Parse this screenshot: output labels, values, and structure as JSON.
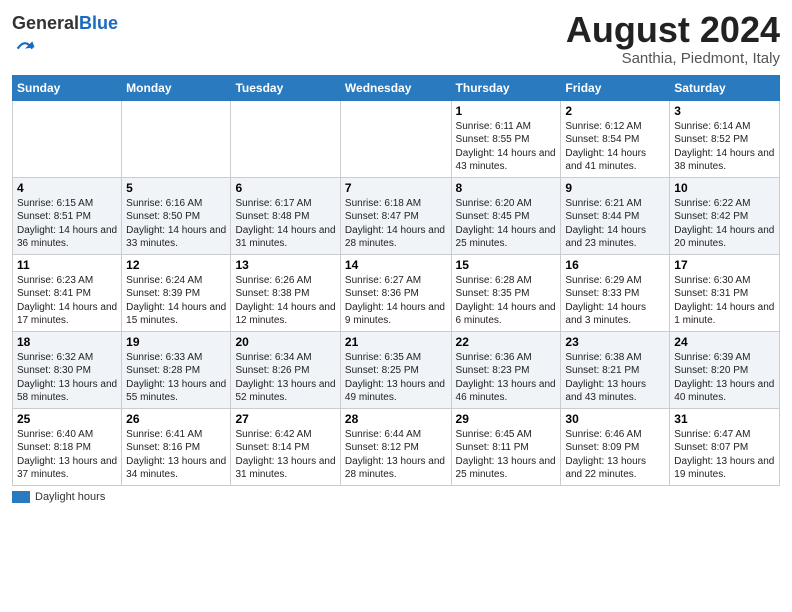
{
  "header": {
    "logo_general": "General",
    "logo_blue": "Blue",
    "month_title": "August 2024",
    "location": "Santhia, Piedmont, Italy"
  },
  "days_of_week": [
    "Sunday",
    "Monday",
    "Tuesday",
    "Wednesday",
    "Thursday",
    "Friday",
    "Saturday"
  ],
  "weeks": [
    [
      {
        "num": "",
        "info": ""
      },
      {
        "num": "",
        "info": ""
      },
      {
        "num": "",
        "info": ""
      },
      {
        "num": "",
        "info": ""
      },
      {
        "num": "1",
        "info": "Sunrise: 6:11 AM\nSunset: 8:55 PM\nDaylight: 14 hours and 43 minutes."
      },
      {
        "num": "2",
        "info": "Sunrise: 6:12 AM\nSunset: 8:54 PM\nDaylight: 14 hours and 41 minutes."
      },
      {
        "num": "3",
        "info": "Sunrise: 6:14 AM\nSunset: 8:52 PM\nDaylight: 14 hours and 38 minutes."
      }
    ],
    [
      {
        "num": "4",
        "info": "Sunrise: 6:15 AM\nSunset: 8:51 PM\nDaylight: 14 hours and 36 minutes."
      },
      {
        "num": "5",
        "info": "Sunrise: 6:16 AM\nSunset: 8:50 PM\nDaylight: 14 hours and 33 minutes."
      },
      {
        "num": "6",
        "info": "Sunrise: 6:17 AM\nSunset: 8:48 PM\nDaylight: 14 hours and 31 minutes."
      },
      {
        "num": "7",
        "info": "Sunrise: 6:18 AM\nSunset: 8:47 PM\nDaylight: 14 hours and 28 minutes."
      },
      {
        "num": "8",
        "info": "Sunrise: 6:20 AM\nSunset: 8:45 PM\nDaylight: 14 hours and 25 minutes."
      },
      {
        "num": "9",
        "info": "Sunrise: 6:21 AM\nSunset: 8:44 PM\nDaylight: 14 hours and 23 minutes."
      },
      {
        "num": "10",
        "info": "Sunrise: 6:22 AM\nSunset: 8:42 PM\nDaylight: 14 hours and 20 minutes."
      }
    ],
    [
      {
        "num": "11",
        "info": "Sunrise: 6:23 AM\nSunset: 8:41 PM\nDaylight: 14 hours and 17 minutes."
      },
      {
        "num": "12",
        "info": "Sunrise: 6:24 AM\nSunset: 8:39 PM\nDaylight: 14 hours and 15 minutes."
      },
      {
        "num": "13",
        "info": "Sunrise: 6:26 AM\nSunset: 8:38 PM\nDaylight: 14 hours and 12 minutes."
      },
      {
        "num": "14",
        "info": "Sunrise: 6:27 AM\nSunset: 8:36 PM\nDaylight: 14 hours and 9 minutes."
      },
      {
        "num": "15",
        "info": "Sunrise: 6:28 AM\nSunset: 8:35 PM\nDaylight: 14 hours and 6 minutes."
      },
      {
        "num": "16",
        "info": "Sunrise: 6:29 AM\nSunset: 8:33 PM\nDaylight: 14 hours and 3 minutes."
      },
      {
        "num": "17",
        "info": "Sunrise: 6:30 AM\nSunset: 8:31 PM\nDaylight: 14 hours and 1 minute."
      }
    ],
    [
      {
        "num": "18",
        "info": "Sunrise: 6:32 AM\nSunset: 8:30 PM\nDaylight: 13 hours and 58 minutes."
      },
      {
        "num": "19",
        "info": "Sunrise: 6:33 AM\nSunset: 8:28 PM\nDaylight: 13 hours and 55 minutes."
      },
      {
        "num": "20",
        "info": "Sunrise: 6:34 AM\nSunset: 8:26 PM\nDaylight: 13 hours and 52 minutes."
      },
      {
        "num": "21",
        "info": "Sunrise: 6:35 AM\nSunset: 8:25 PM\nDaylight: 13 hours and 49 minutes."
      },
      {
        "num": "22",
        "info": "Sunrise: 6:36 AM\nSunset: 8:23 PM\nDaylight: 13 hours and 46 minutes."
      },
      {
        "num": "23",
        "info": "Sunrise: 6:38 AM\nSunset: 8:21 PM\nDaylight: 13 hours and 43 minutes."
      },
      {
        "num": "24",
        "info": "Sunrise: 6:39 AM\nSunset: 8:20 PM\nDaylight: 13 hours and 40 minutes."
      }
    ],
    [
      {
        "num": "25",
        "info": "Sunrise: 6:40 AM\nSunset: 8:18 PM\nDaylight: 13 hours and 37 minutes."
      },
      {
        "num": "26",
        "info": "Sunrise: 6:41 AM\nSunset: 8:16 PM\nDaylight: 13 hours and 34 minutes."
      },
      {
        "num": "27",
        "info": "Sunrise: 6:42 AM\nSunset: 8:14 PM\nDaylight: 13 hours and 31 minutes."
      },
      {
        "num": "28",
        "info": "Sunrise: 6:44 AM\nSunset: 8:12 PM\nDaylight: 13 hours and 28 minutes."
      },
      {
        "num": "29",
        "info": "Sunrise: 6:45 AM\nSunset: 8:11 PM\nDaylight: 13 hours and 25 minutes."
      },
      {
        "num": "30",
        "info": "Sunrise: 6:46 AM\nSunset: 8:09 PM\nDaylight: 13 hours and 22 minutes."
      },
      {
        "num": "31",
        "info": "Sunrise: 6:47 AM\nSunset: 8:07 PM\nDaylight: 13 hours and 19 minutes."
      }
    ]
  ],
  "legend": {
    "label": "Daylight hours"
  }
}
